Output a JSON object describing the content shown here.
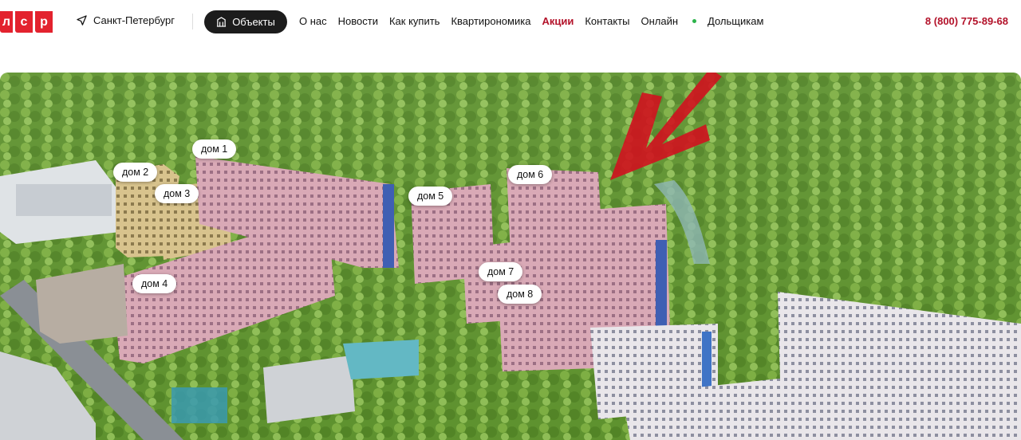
{
  "header": {
    "logo_letters": [
      "л",
      "с",
      "р"
    ],
    "city": "Санкт-Петербург",
    "objects_button": "Объекты",
    "nav": [
      {
        "label": "О нас"
      },
      {
        "label": "Новости"
      },
      {
        "label": "Как купить"
      },
      {
        "label": "Квартирономика"
      },
      {
        "label": "Акции",
        "highlight": true
      },
      {
        "label": "Контакты"
      },
      {
        "label": "Онлайн",
        "status": "online"
      },
      {
        "label": "Дольщикам"
      }
    ],
    "phone": "8 (800) 775-89-68"
  },
  "colors": {
    "brand_red": "#e3222e",
    "accent_dark_red": "#b3122a",
    "button_dark": "#1c1c1c",
    "online_green": "#2bb34a"
  },
  "render": {
    "building_pins": [
      "дом 1",
      "дом 2",
      "дом 3",
      "дом 4",
      "дом 5",
      "дом 6",
      "дом 7",
      "дом 8"
    ]
  }
}
